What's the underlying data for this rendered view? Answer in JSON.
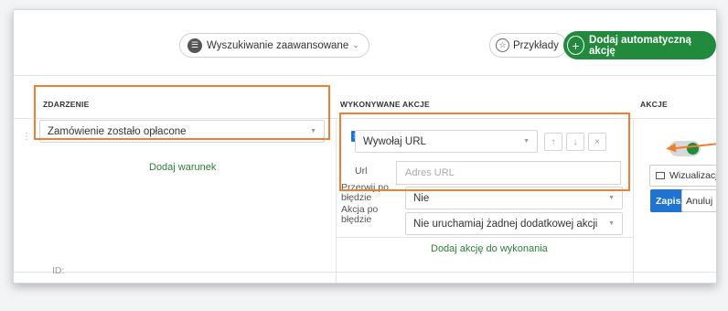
{
  "toolbar": {
    "advanced_search_label": "Wyszukiwanie zaawansowane",
    "examples_label": "Przykłady",
    "add_action_label": "Dodaj automatyczną akcję"
  },
  "columns": {
    "event": "ZDARZENIE",
    "actions_performed": "WYKONYWANE AKCJE",
    "actions": "AKCJE"
  },
  "event": {
    "selected": "Zamówienie zostało opłacone",
    "add_condition": "Dodaj warunek",
    "id_label": "ID:"
  },
  "action": {
    "number": "1.",
    "type_selected": "Wywołaj URL",
    "url_label": "Url",
    "url_placeholder": "Adres URL",
    "stop_on_error_label": "Przerwij po błędzie",
    "stop_on_error_value": "Nie",
    "action_on_error_label": "Akcja po błędzie",
    "action_on_error_value": "Nie uruchamiaj żadnej dodatkowej akcji",
    "add_action": "Dodaj akcję do wykonania"
  },
  "row_actions": {
    "preview": "Wizualizacja",
    "save": "Zapisz",
    "cancel": "Anuluj",
    "toggle_enabled": true
  },
  "colors": {
    "accent_green": "#218a3d",
    "primary_blue": "#1f74d1",
    "highlight_orange": "#f07f2f"
  }
}
